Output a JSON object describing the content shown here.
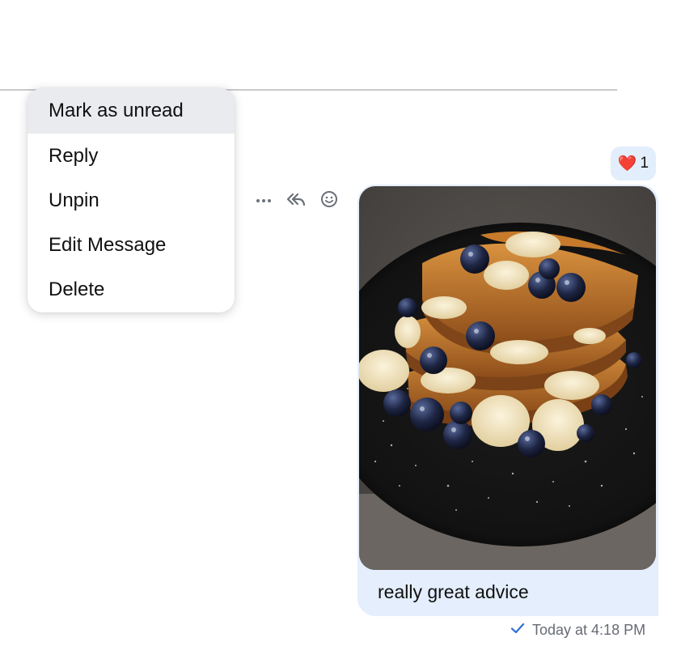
{
  "context_menu": {
    "items": [
      {
        "label": "Mark as unread"
      },
      {
        "label": "Reply"
      },
      {
        "label": "Unpin"
      },
      {
        "label": "Edit Message"
      },
      {
        "label": "Delete"
      }
    ]
  },
  "hover_toolbar": {
    "icons": [
      "more-horizontal-icon",
      "reply-all-icon",
      "emoji-icon"
    ]
  },
  "reaction": {
    "emoji": "❤️",
    "count": "1"
  },
  "message": {
    "text": "really great advice",
    "image": "french-toast-photo",
    "timestamp": "Today at 4:18 PM",
    "status_icon": "checkmark-icon"
  },
  "colors": {
    "bubble": "#e4eefc",
    "menu_active": "#eaebef",
    "check": "#2f6fdb",
    "time": "#666b73"
  }
}
